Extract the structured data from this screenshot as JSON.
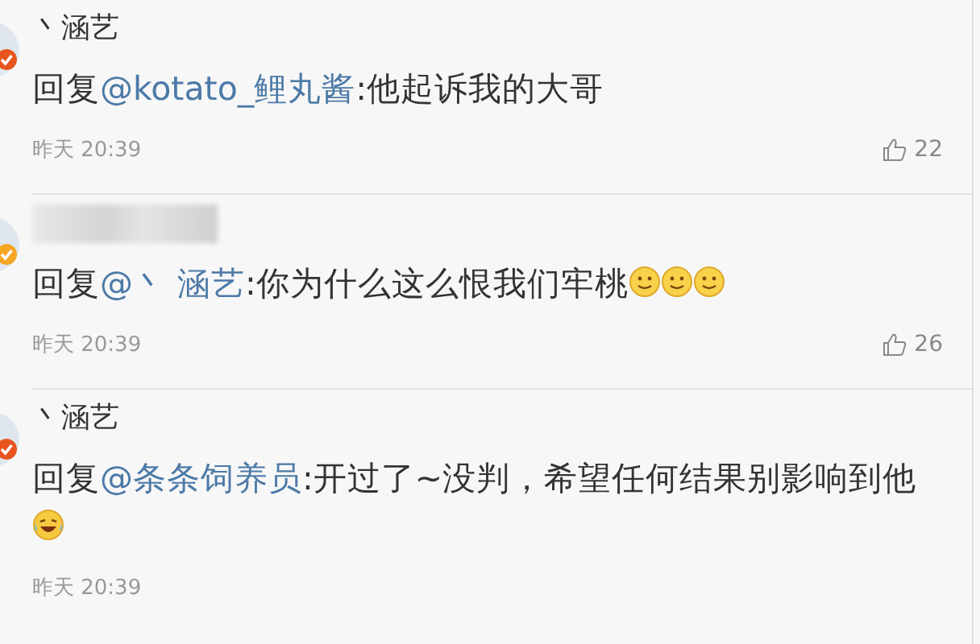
{
  "comments": [
    {
      "username": "丶涵艺",
      "name_hidden": false,
      "badge": {
        "color": "#e8541e"
      },
      "prefix": "回复",
      "mention": "@kotato_鲤丸酱",
      "text": ":他起诉我的大哥",
      "time": "昨天 20:39",
      "likes": "22"
    },
    {
      "name_hidden": true,
      "badge": {
        "color": "#f5a623"
      },
      "prefix": "回复",
      "mention": "@丶 涵艺",
      "text": ":你为什么这么恨我们牢桃",
      "emojis": [
        {
          "kind": "smile"
        },
        {
          "kind": "smile"
        },
        {
          "kind": "smile"
        }
      ],
      "time": "昨天 20:39",
      "likes": "26"
    },
    {
      "username": "丶涵艺",
      "name_hidden": false,
      "badge": {
        "color": "#e8541e"
      },
      "prefix": "回复",
      "mention": "@条条饲养员",
      "text": ":开过了~没判，希望任何结果别影响到他",
      "emojis": [
        {
          "kind": "laugh"
        }
      ],
      "time": "昨天 20:39"
    }
  ]
}
